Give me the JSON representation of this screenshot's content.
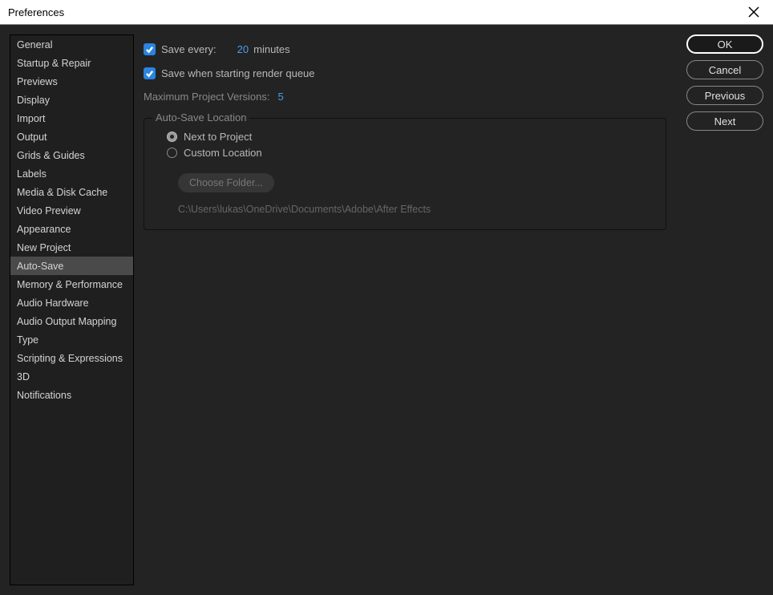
{
  "window": {
    "title": "Preferences"
  },
  "sidebar": {
    "items": [
      "General",
      "Startup & Repair",
      "Previews",
      "Display",
      "Import",
      "Output",
      "Grids & Guides",
      "Labels",
      "Media & Disk Cache",
      "Video Preview",
      "Appearance",
      "New Project",
      "Auto-Save",
      "Memory & Performance",
      "Audio Hardware",
      "Audio Output Mapping",
      "Type",
      "Scripting & Expressions",
      "3D",
      "Notifications"
    ],
    "selected_index": 12
  },
  "content": {
    "save_every": {
      "checked": true,
      "label": "Save every:",
      "value": "20",
      "unit": "minutes"
    },
    "save_on_render": {
      "checked": true,
      "label": "Save when starting render queue"
    },
    "max_versions": {
      "label": "Maximum Project Versions:",
      "value": "5"
    },
    "location": {
      "title": "Auto-Save Location",
      "options": [
        {
          "label": "Next to Project",
          "selected": true
        },
        {
          "label": "Custom Location",
          "selected": false
        }
      ],
      "choose_btn": "Choose Folder...",
      "path": "C:\\Users\\lukas\\OneDrive\\Documents\\Adobe\\After Effects"
    }
  },
  "buttons": {
    "ok": "OK",
    "cancel": "Cancel",
    "previous": "Previous",
    "next": "Next"
  }
}
